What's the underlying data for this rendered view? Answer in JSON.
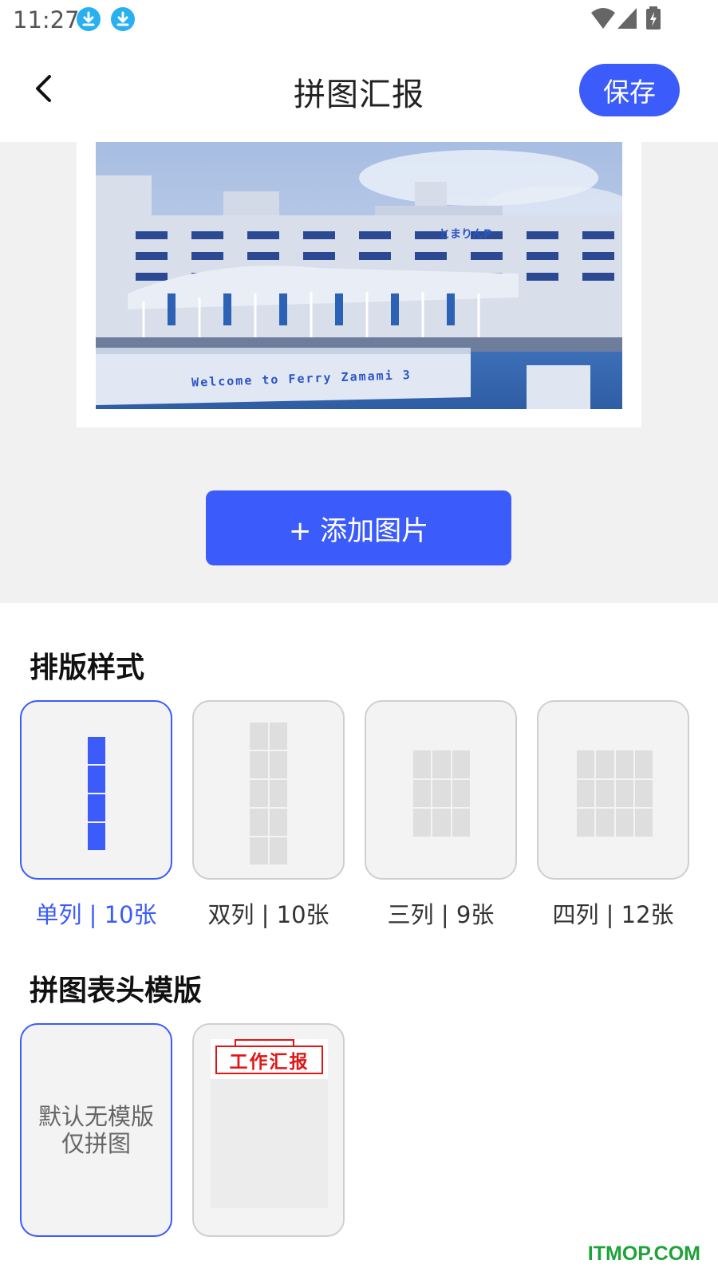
{
  "status_bar": {
    "time": "11:27",
    "icons": [
      "download-icon",
      "download-icon",
      "wifi-icon",
      "signal-icon",
      "battery-charging-icon"
    ]
  },
  "header": {
    "back_icon": "chevron-left-icon",
    "title": "拼图汇报",
    "save_label": "保存"
  },
  "preview": {
    "photo_caption": "Welcome to Ferry Zamami 3",
    "photo_signage": "とまりんP",
    "add_image_label": "+ 添加图片"
  },
  "layout_section": {
    "title": "排版样式",
    "options": [
      {
        "label": "单列 | 10张",
        "selected": true
      },
      {
        "label": "双列 | 10张",
        "selected": false
      },
      {
        "label": "三列 | 9张",
        "selected": false
      },
      {
        "label": "四列 | 12张",
        "selected": false
      }
    ]
  },
  "template_section": {
    "title": "拼图表头模版",
    "templates": [
      {
        "line1": "默认无模版",
        "line2": "仅拼图",
        "selected": true
      },
      {
        "stamp_text": "工作汇报",
        "selected": false
      }
    ]
  },
  "watermark": "ITMOP.COM",
  "colors": {
    "accent": "#3b5bfb",
    "background_gray": "#f1f1f1",
    "card_gray": "#f3f3f3",
    "stamp_red": "#e01616",
    "watermark_green": "#1fa23a"
  }
}
